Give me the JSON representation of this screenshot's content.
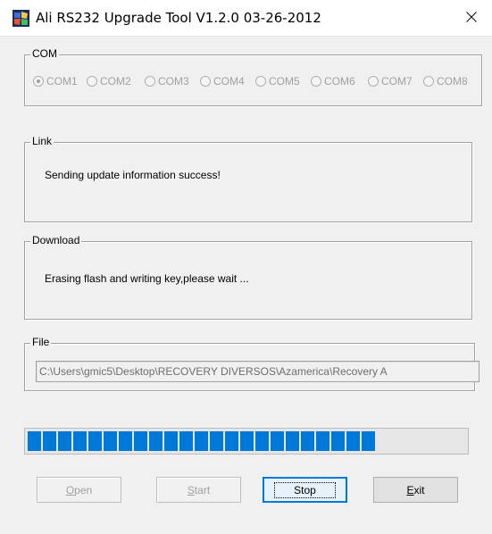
{
  "window": {
    "title": "Ali RS232 Upgrade Tool   V1.2.0  03-26-2012",
    "close_glyph": "✕"
  },
  "com_group": {
    "legend": "COM",
    "ports": [
      {
        "label": "COM1",
        "selected": true
      },
      {
        "label": "COM2",
        "selected": false
      },
      {
        "label": "COM3",
        "selected": false
      },
      {
        "label": "COM4",
        "selected": false
      },
      {
        "label": "COM5",
        "selected": false
      },
      {
        "label": "COM6",
        "selected": false
      },
      {
        "label": "COM7",
        "selected": false
      },
      {
        "label": "COM8",
        "selected": false
      }
    ]
  },
  "link_group": {
    "legend": "Link",
    "message": "Sending update information success!"
  },
  "download_group": {
    "legend": "Download",
    "message": "Erasing flash and writing key,please wait ..."
  },
  "file_group": {
    "legend": "File",
    "path": "C:\\Users\\gmic5\\Desktop\\RECOVERY DIVERSOS\\Azamerica\\Recovery A"
  },
  "progress": {
    "filled_blocks": 23,
    "total_blocks": 27,
    "color": "#0078d7"
  },
  "buttons": {
    "open": {
      "mnemonic": "O",
      "rest": "pen",
      "enabled": false
    },
    "start": {
      "mnemonic": "S",
      "rest": "tart",
      "enabled": false
    },
    "stop": {
      "label": "Stop",
      "enabled": true,
      "default": true
    },
    "exit": {
      "mnemonic": "E",
      "rest": "xit",
      "enabled": true
    }
  }
}
